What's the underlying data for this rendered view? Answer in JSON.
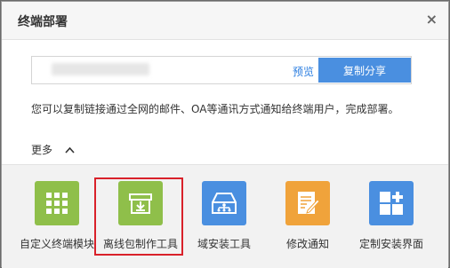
{
  "dialog": {
    "title": "终端部署",
    "close_label": "×",
    "preview_label": "预览",
    "copy_button_label": "复制分享",
    "description": "您可以复制链接通过全网的邮件、OA等通讯方式通知给终端用户，完成部署。",
    "more_label": "更多",
    "more_icon": "chevron-up",
    "tools": [
      {
        "label": "自定义终端模块",
        "icon": "grid-icon",
        "color": "#8fbf4a"
      },
      {
        "label": "离线包制作工具",
        "icon": "box-download-icon",
        "color": "#8fbf4a"
      },
      {
        "label": "域安装工具",
        "icon": "network-tray-icon",
        "color": "#4a8fe0"
      },
      {
        "label": "修改通知",
        "icon": "edit-note-icon",
        "color": "#f0a33b"
      },
      {
        "label": "定制安装界面",
        "icon": "layout-plus-icon",
        "color": "#4a8fe0"
      }
    ],
    "selected_tool": "离线包制作工具"
  }
}
